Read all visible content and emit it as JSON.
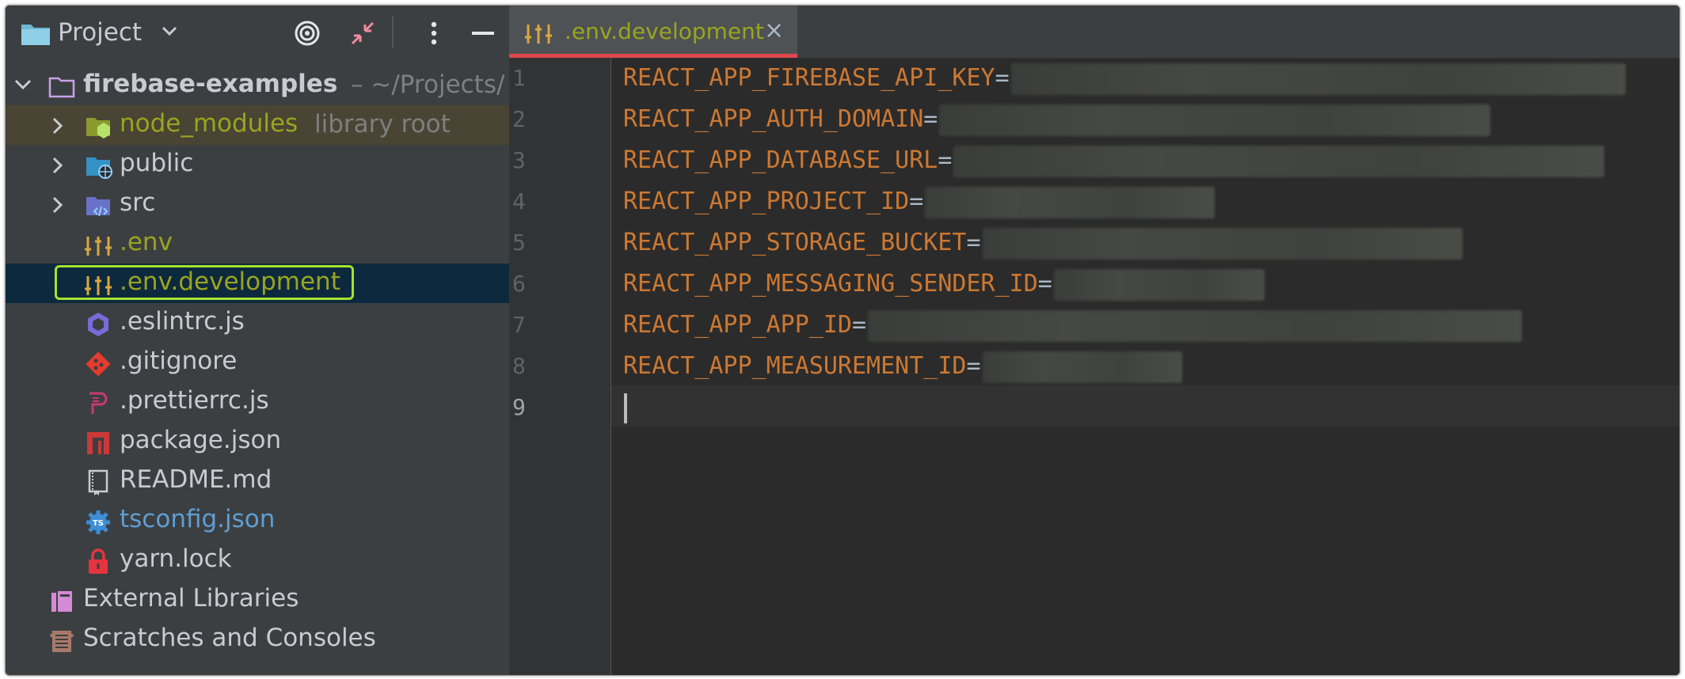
{
  "project_panel": {
    "title": "Project",
    "root": {
      "name": "firebase-examples",
      "path": "~/Projects/"
    },
    "items": [
      {
        "label": "node_modules",
        "hint": "library root"
      },
      {
        "label": "public"
      },
      {
        "label": "src"
      },
      {
        "label": ".env"
      },
      {
        "label": ".env.development"
      },
      {
        "label": ".eslintrc.js"
      },
      {
        "label": ".gitignore"
      },
      {
        "label": ".prettierrc.js"
      },
      {
        "label": "package.json"
      },
      {
        "label": "README.md"
      },
      {
        "label": "tsconfig.json"
      },
      {
        "label": "yarn.lock"
      }
    ],
    "external_libraries": "External Libraries",
    "scratches": "Scratches and Consoles"
  },
  "editor": {
    "tab_label": ".env.development",
    "close_glyph": "×",
    "line_numbers": [
      "1",
      "2",
      "3",
      "4",
      "5",
      "6",
      "7",
      "8",
      "9"
    ],
    "lines": [
      {
        "key": "REACT_APP_FIREBASE_API_KEY",
        "eq": "="
      },
      {
        "key": "REACT_APP_AUTH_DOMAIN",
        "eq": "="
      },
      {
        "key": "REACT_APP_DATABASE_URL",
        "eq": "="
      },
      {
        "key": "REACT_APP_PROJECT_ID",
        "eq": "="
      },
      {
        "key": "REACT_APP_STORAGE_BUCKET",
        "eq": "="
      },
      {
        "key": "REACT_APP_MESSAGING_SENDER_ID",
        "eq": "="
      },
      {
        "key": "REACT_APP_APP_ID",
        "eq": "="
      },
      {
        "key": "REACT_APP_MEASUREMENT_ID",
        "eq": "="
      }
    ]
  },
  "colors": {
    "key": "#cc7832",
    "modified_file": "#9aa41f",
    "selection_outline": "#a6e22e",
    "tab_underline": "#e0474c"
  }
}
